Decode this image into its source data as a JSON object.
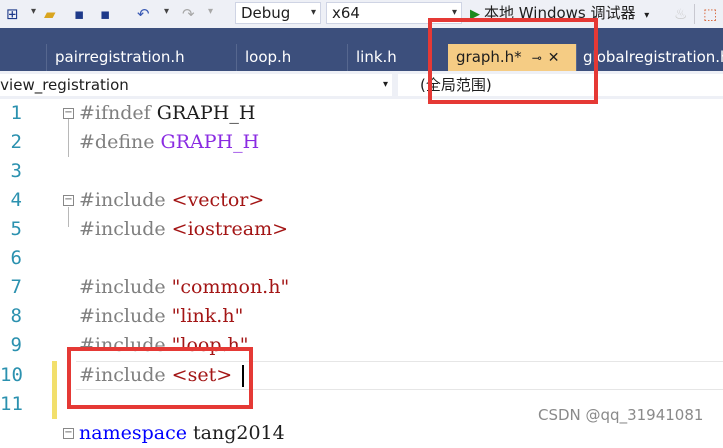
{
  "toolbar": {
    "config_value": "Debug",
    "platform_value": "x64",
    "run_label": "本地 Windows 调试器"
  },
  "tabs": [
    {
      "label": "pairregistration.h"
    },
    {
      "label": "loop.h"
    },
    {
      "label": "link.h"
    },
    {
      "label": "graph.h*"
    },
    {
      "label": "globalregistration.h"
    }
  ],
  "nav": {
    "project_scope": "iview_registration",
    "member_scope": "(全局范围)"
  },
  "editor": {
    "line_numbers": [
      "1",
      "2",
      "3",
      "4",
      "5",
      "6",
      "7",
      "8",
      "9",
      "10",
      "11"
    ],
    "lines": {
      "l1_directive": "#ifndef",
      "l1_macro": "GRAPH_H",
      "l2_directive": "#define",
      "l2_macro": "GRAPH_H",
      "l4_directive": "#include",
      "l4_header": "<vector>",
      "l5_directive": "#include",
      "l5_header": "<iostream>",
      "l7_directive": "#include",
      "l7_header": "\"common.h\"",
      "l8_directive": "#include",
      "l8_header": "\"link.h\"",
      "l9_directive": "#include",
      "l9_header": "\"loop.h\"",
      "l10_directive": "#include",
      "l10_header": "<set>",
      "l12_keyword": "namespace",
      "l12_name": "tang2014"
    }
  },
  "watermark": "CSDN @qq_31941081",
  "colors": {
    "tab_strip": "#3c4f7c",
    "active_tab": "#f5cc84",
    "highlight_box": "#e53935",
    "line_number": "#2b91af",
    "macro": "#8a2be2",
    "string": "#a31515"
  }
}
